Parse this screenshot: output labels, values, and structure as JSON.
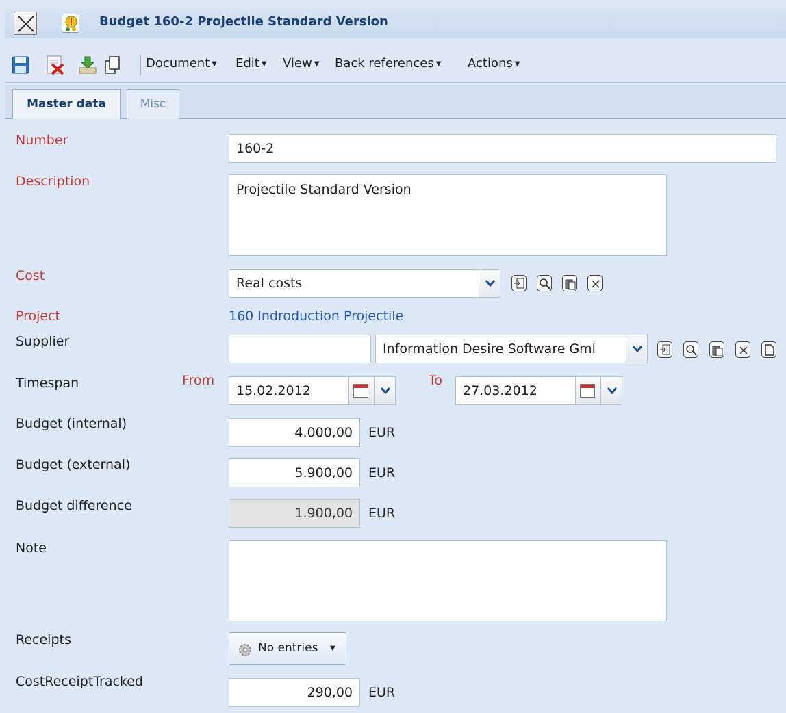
{
  "window": {
    "title": "Budget 160-2 Projectile Standard Version"
  },
  "toolbar": {
    "icons": [
      "save-icon",
      "delete-icon",
      "export-icon",
      "copy-icon"
    ],
    "menus": [
      "Document",
      "Edit",
      "View",
      "Back references",
      "Actions"
    ]
  },
  "tabs": [
    "Master data",
    "Misc"
  ],
  "fields": {
    "number": {
      "label": "Number",
      "value": "160-2"
    },
    "description": {
      "label": "Description",
      "value": "Projectile Standard Version"
    },
    "cost": {
      "label": "Cost",
      "value": "Real costs"
    },
    "project": {
      "label": "Project",
      "value": "160 Indroduction Projectile"
    },
    "supplier": {
      "label": "Supplier",
      "code": "",
      "value": "Information Desire Software Gml"
    },
    "timespan": {
      "label": "Timespan",
      "from_label": "From",
      "from": "15.02.2012",
      "to_label": "To",
      "to": "27.03.2012"
    },
    "budget_internal": {
      "label": "Budget (internal)",
      "value": "4.000,00",
      "unit": "EUR"
    },
    "budget_external": {
      "label": "Budget (external)",
      "value": "5.900,00",
      "unit": "EUR"
    },
    "budget_difference": {
      "label": "Budget difference",
      "value": "1.900,00",
      "unit": "EUR"
    },
    "note": {
      "label": "Note",
      "value": ""
    },
    "receipts": {
      "label": "Receipts",
      "button": "No entries"
    },
    "cost_receipt_tracked": {
      "label": "CostReceiptTracked",
      "value": "290,00",
      "unit": "EUR"
    }
  },
  "colors": {
    "required_label": "#c53a3a",
    "link": "#2358c6",
    "title": "#1c3f78",
    "background": "#dde8f6"
  }
}
